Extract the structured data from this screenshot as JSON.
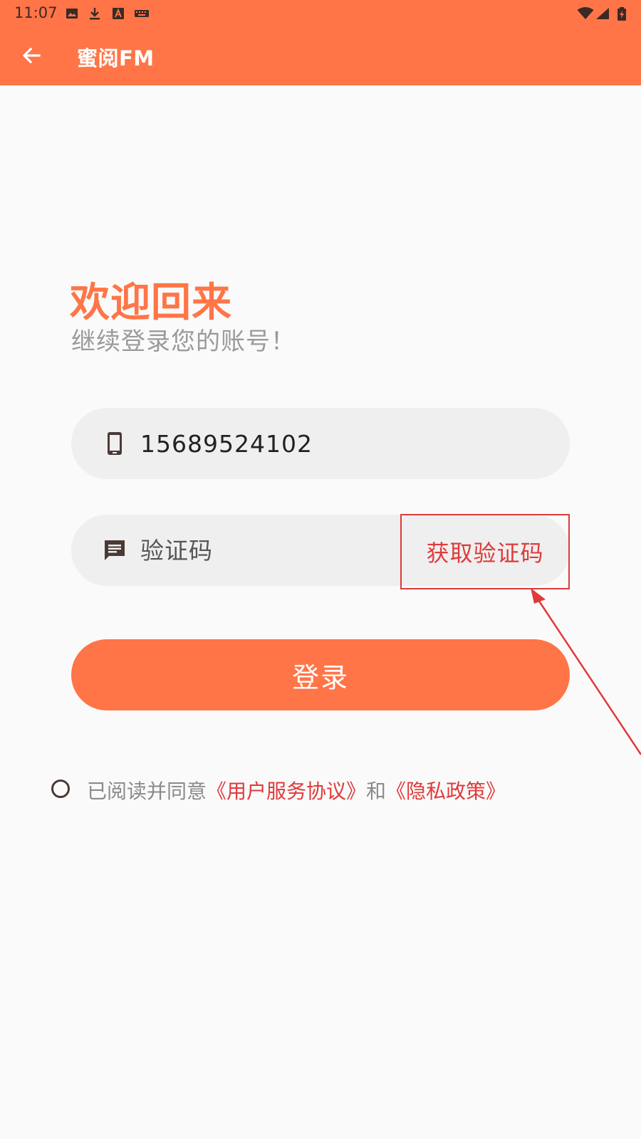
{
  "status_bar": {
    "time": "11:07",
    "left_icons": [
      "image-icon",
      "download-icon",
      "font-a-icon",
      "keyboard-icon"
    ],
    "right_icons": [
      "wifi-icon",
      "signal-icon",
      "battery-charging-icon"
    ]
  },
  "app_bar": {
    "back_icon": "arrow-left-icon",
    "title": "蜜阅FM"
  },
  "welcome": {
    "title": "欢迎回来",
    "subtitle": "继续登录您的账号！"
  },
  "phone_field": {
    "icon": "smartphone-icon",
    "value": "15689524102"
  },
  "code_field": {
    "icon": "message-icon",
    "placeholder": "验证码",
    "value": "",
    "get_code_label": "获取验证码"
  },
  "login_button": {
    "label": "登录"
  },
  "agreement": {
    "prefix": "已阅读并同意",
    "terms_link": "《用户服务协议》",
    "conjunction": "和",
    "privacy_link": "《隐私政策》",
    "checked": false
  },
  "colors": {
    "brand": "#ff7547",
    "annotation": "#e03a3a",
    "field_bg": "#efefef",
    "page_bg": "#fafafa"
  }
}
